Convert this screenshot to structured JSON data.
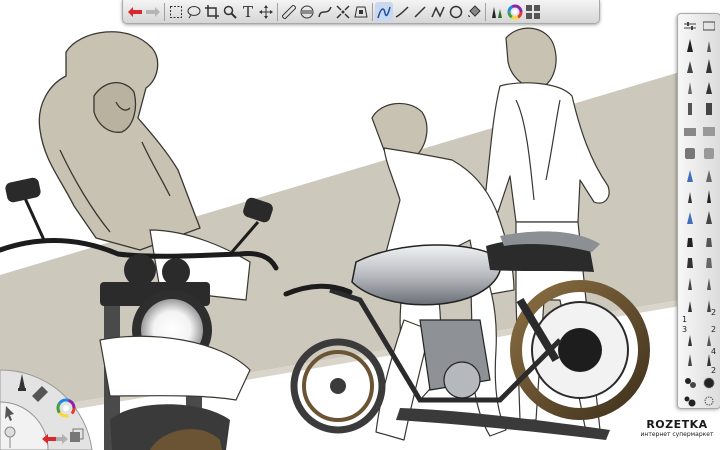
{
  "colors": {
    "paper": "#ffffff",
    "band": "#cdc8bc",
    "sketch_tone": "#c8c2b2",
    "line": "#2a2a2a",
    "tank": "#d7d9dc",
    "tire": "#6b5434",
    "toolbar_bg": "#e6e6e6",
    "undo_arrow": "#d8282b",
    "selection_highlight": "#c9d8ef"
  },
  "toolbar": {
    "tools": [
      {
        "id": "undo",
        "icon": "undo-arrow-icon"
      },
      {
        "id": "redo",
        "icon": "redo-arrow-icon"
      },
      {
        "id": "rect-select",
        "icon": "rectangle-select-icon"
      },
      {
        "id": "lasso",
        "icon": "lasso-icon"
      },
      {
        "id": "crop",
        "icon": "crop-icon"
      },
      {
        "id": "zoom",
        "icon": "magnifier-icon"
      },
      {
        "id": "text",
        "icon": "text-icon",
        "glyph": "T"
      },
      {
        "id": "transform",
        "icon": "move-arrows-icon"
      },
      {
        "id": "ruler",
        "icon": "ruler-icon"
      },
      {
        "id": "ellipse-guide",
        "icon": "ellipse-guide-icon"
      },
      {
        "id": "french-curve",
        "icon": "french-curve-icon"
      },
      {
        "id": "symmetry",
        "icon": "symmetry-icon"
      },
      {
        "id": "perspective",
        "icon": "perspective-icon"
      },
      {
        "id": "freehand",
        "icon": "freehand-stroke-icon",
        "selected": true
      },
      {
        "id": "steady-stroke",
        "icon": "steady-stroke-icon"
      },
      {
        "id": "line",
        "icon": "line-icon"
      },
      {
        "id": "polyline",
        "icon": "polyline-icon"
      },
      {
        "id": "circle",
        "icon": "circle-icon"
      },
      {
        "id": "fill",
        "icon": "fill-icon"
      },
      {
        "id": "brush-library",
        "icon": "brush-library-icon"
      },
      {
        "id": "color-wheel",
        "icon": "color-wheel-icon"
      },
      {
        "id": "layers",
        "icon": "layers-icon"
      }
    ]
  },
  "brush_palette": {
    "badges": [
      "1",
      "2",
      "3",
      "2",
      "4",
      "2"
    ]
  },
  "watermark": {
    "title": "ROZETKA",
    "subtitle": "интернет супермаркет"
  }
}
